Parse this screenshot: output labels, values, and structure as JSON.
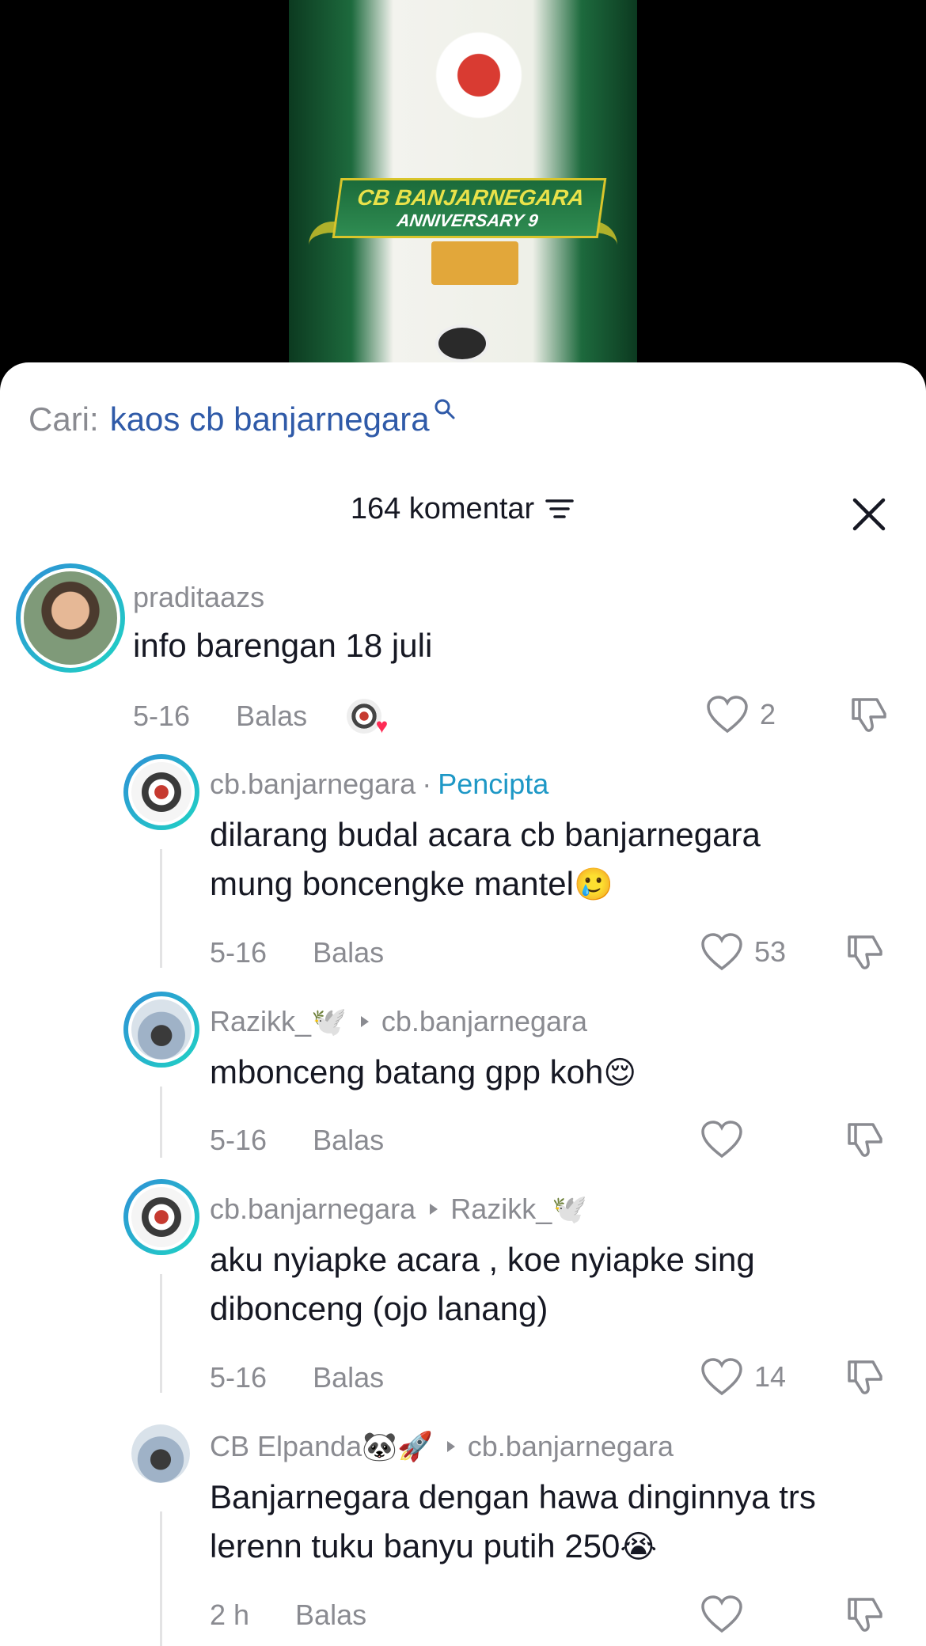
{
  "video": {
    "banner_line1": "CB BANJARNEGARA",
    "banner_line2": "ANNIVERSARY 9"
  },
  "search": {
    "label": "Cari:",
    "query": "kaos cb banjarnegara"
  },
  "header": {
    "count_label": "164 komentar"
  },
  "comments": [
    {
      "username": "praditaazs",
      "text": "info barengan 18 juli",
      "date": "5-16",
      "reply_label": "Balas",
      "likes": "2"
    },
    {
      "username": "cb.banjarnegara",
      "badge": "Pencipta",
      "text_line1": "dilarang budal acara cb banjarnegara",
      "text_line2": "mung boncengke mantel",
      "emoji": "🥲",
      "date": "5-16",
      "reply_label": "Balas",
      "likes": "53"
    },
    {
      "username": "Razikk_🕊️",
      "reply_to": "cb.banjarnegara",
      "text": "mbonceng batang gpp koh",
      "emoji": "😌",
      "date": "5-16",
      "reply_label": "Balas",
      "likes": ""
    },
    {
      "username": "cb.banjarnegara",
      "reply_to": "Razikk_🕊️",
      "text_line1": "aku nyiapke acara , koe nyiapke sing",
      "text_line2": "dibonceng (ojo lanang)",
      "date": "5-16",
      "reply_label": "Balas",
      "likes": "14"
    },
    {
      "username": "CB Elpanda🐼🚀",
      "reply_to": "cb.banjarnegara",
      "text_line1": "Banjarnegara dengan hawa dinginnya trs",
      "text_line2": "lerenn tuku banyu putih 250",
      "emoji": "😭",
      "date": "2 h",
      "reply_label": "Balas",
      "likes": ""
    }
  ],
  "colors": {
    "accent_link": "#2f5aa8",
    "creator_badge": "#1e98c6",
    "like_heart": "#fe2c55",
    "ring_start": "#2e8fd6",
    "ring_end": "#20d3c4"
  }
}
